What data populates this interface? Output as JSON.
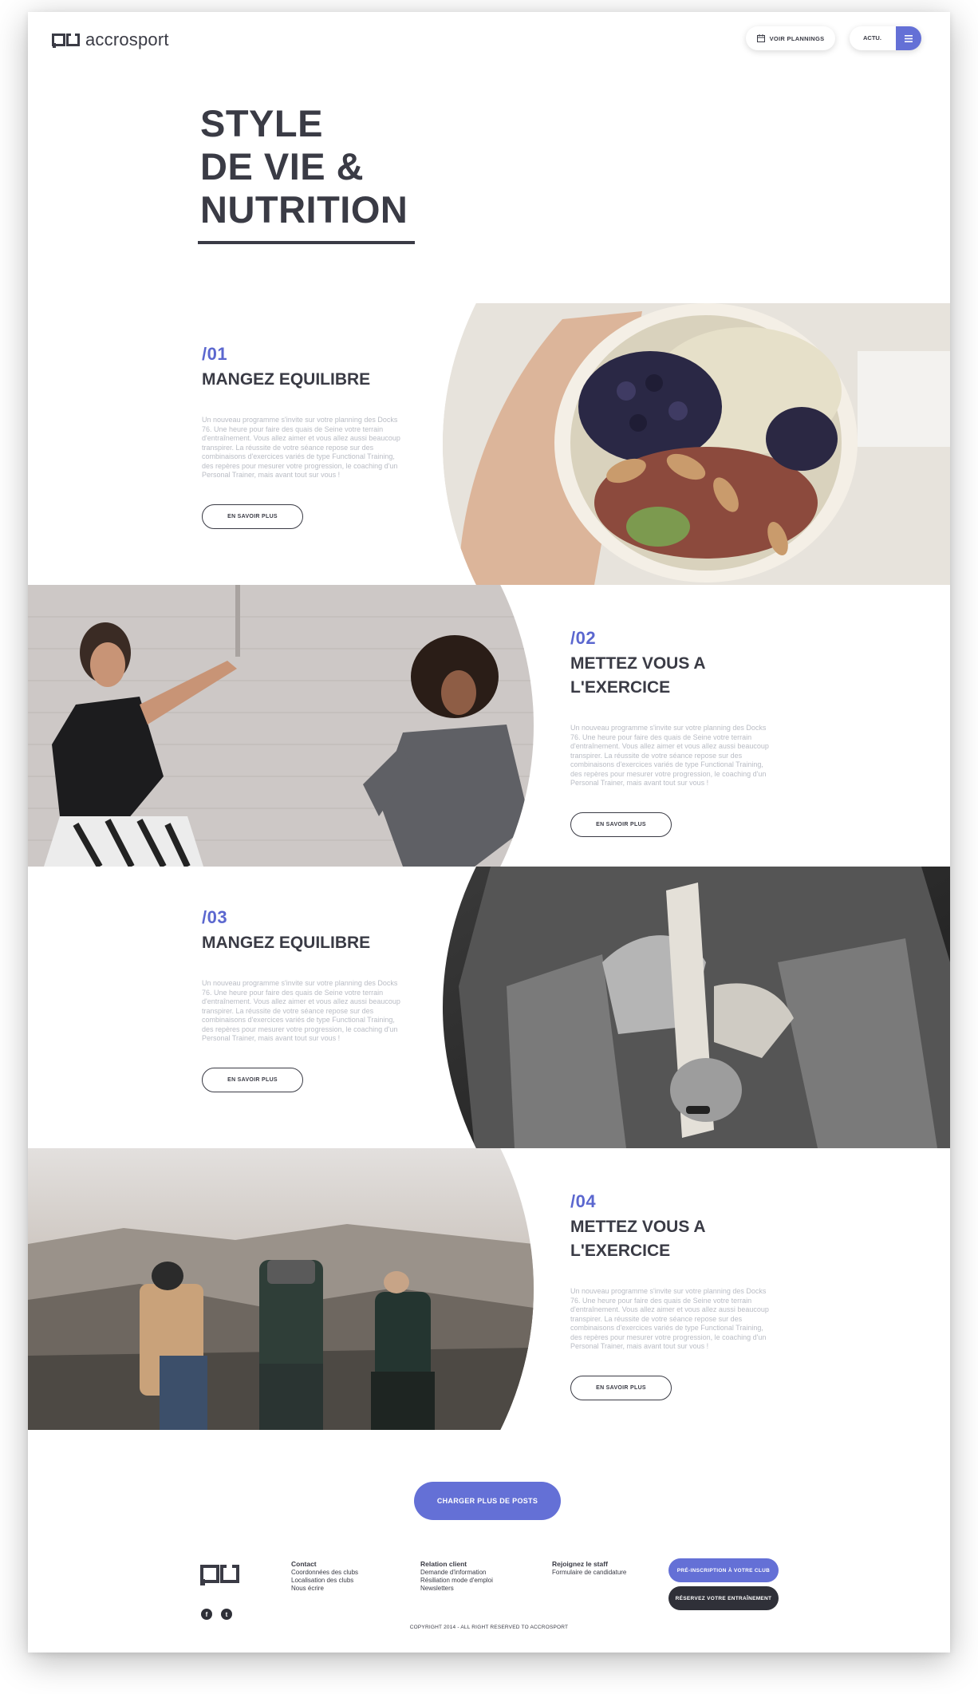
{
  "brand": {
    "name": "accrosport"
  },
  "header": {
    "plannings_label": "VOIR PLANNINGS",
    "actu_label": "ACTU."
  },
  "title": {
    "line1": "STYLE",
    "line2": "DE VIE &",
    "line3": "NUTRITION"
  },
  "posts": [
    {
      "number": "/01",
      "heading": "MANGEZ EQUILIBRE",
      "text": "Un nouveau programme s'invite sur votre planning des Docks 76. Une heure pour faire des quais de Seine votre terrain d'entraînement. Vous allez aimer et vous allez aussi beaucoup transpirer. La réussite de votre séance repose sur des combinaisons d'exercices variés de type Functional Training, des repères pour mesurer votre progression, le coaching d'un Personal Trainer, mais avant tout sur vous !",
      "button": "EN SAVOIR PLUS",
      "image": "bowl-food-photo"
    },
    {
      "number": "/02",
      "heading": "METTEZ VOUS A L'EXERCICE",
      "text": "Un nouveau programme s'invite sur votre planning des Docks 76. Une heure pour faire des quais de Seine votre terrain d'entraînement. Vous allez aimer et vous allez aussi beaucoup transpirer. La réussite de votre séance repose sur des combinaisons d'exercices variés de type Functional Training, des repères pour mesurer votre progression, le coaching d'un Personal Trainer, mais avant tout sur vous !",
      "button": "EN SAVOIR PLUS",
      "image": "women-exercising-photo"
    },
    {
      "number": "/03",
      "heading": "MANGEZ EQUILIBRE",
      "text": "Un nouveau programme s'invite sur votre planning des Docks 76. Une heure pour faire des quais de Seine votre terrain d'entraînement. Vous allez aimer et vous allez aussi beaucoup transpirer. La réussite de votre séance repose sur des combinaisons d'exercices variés de type Functional Training, des repères pour mesurer votre progression, le coaching d'un Personal Trainer, mais avant tout sur vous !",
      "button": "EN SAVOIR PLUS",
      "image": "boxer-wrapping-hands-photo"
    },
    {
      "number": "/04",
      "heading": "METTEZ VOUS A L'EXERCICE",
      "text": "Un nouveau programme s'invite sur votre planning des Docks 76. Une heure pour faire des quais de Seine votre terrain d'entraînement. Vous allez aimer et vous allez aussi beaucoup transpirer. La réussite de votre séance repose sur des combinaisons d'exercices variés de type Functional Training, des repères pour mesurer votre progression, le coaching d'un Personal Trainer, mais avant tout sur vous !",
      "button": "EN SAVOIR PLUS",
      "image": "hikers-backpacks-photo"
    }
  ],
  "load_more": "CHARGER PLUS DE POSTS",
  "footer": {
    "col1": {
      "title": "Contact",
      "links": [
        "Coordonnées des clubs",
        "Localisation des clubs",
        "Nous écrire"
      ]
    },
    "col2": {
      "title": "Relation client",
      "links": [
        "Demande d'information",
        "Résiliation mode d'emploi",
        "Newsletters"
      ]
    },
    "col3": {
      "title": "Rejoignez le staff",
      "links": [
        "Formulaire de candidature"
      ]
    },
    "preinscription": "PRÉ-INSCRIPTION À VOTRE CLUB",
    "reserve": "RÉSERVEZ VOTRE ENTRAÎNEMENT",
    "social": {
      "facebook": "f",
      "twitter": "t"
    },
    "copyright": "COPYRIGHT 2014 - ALL RIGHT RESERVED TO ACCROSPORT"
  },
  "colors": {
    "accent": "#6470d6",
    "text": "#3a3b45",
    "muted": "#b9bcc4",
    "dark_button": "#2f3038"
  }
}
